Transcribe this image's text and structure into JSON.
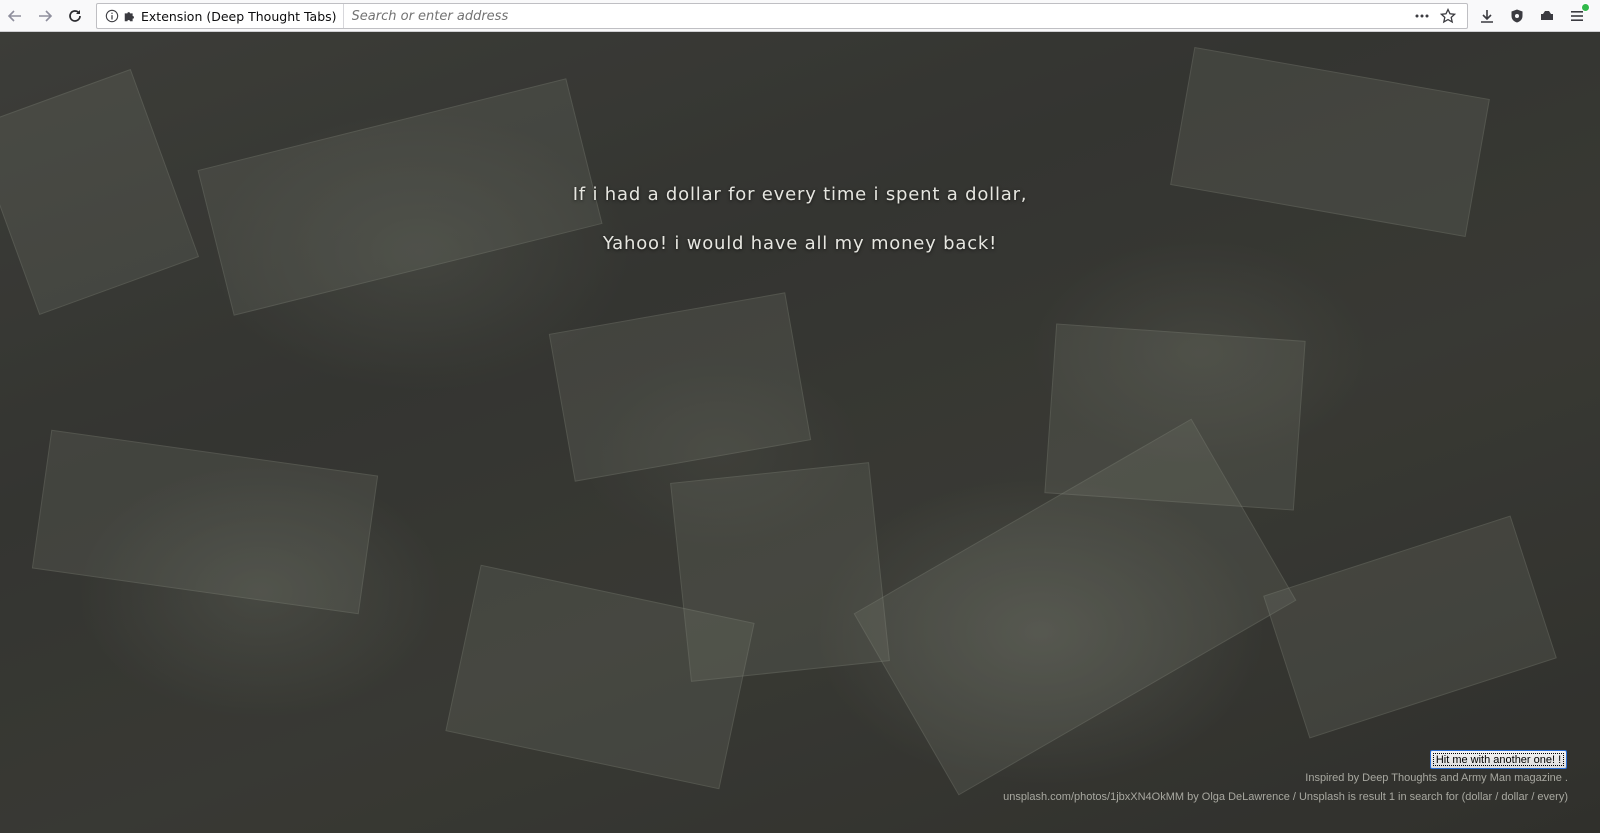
{
  "browser": {
    "nav": {
      "back_icon": "back-arrow-icon",
      "forward_icon": "forward-arrow-icon",
      "reload_icon": "reload-icon"
    },
    "urlbar": {
      "identity_label": "Extension (Deep Thought Tabs)",
      "placeholder": "Search or enter address",
      "actions": [
        "more-dots-icon",
        "bookmark-star-icon"
      ]
    },
    "toolbar_icons": [
      "download-icon",
      "shield-extension-icon",
      "sidebar-icon",
      "menu-icon"
    ],
    "colors": {
      "toolbar_bg": "#f9f9fa",
      "badge": "#30b94a"
    }
  },
  "page": {
    "quote_line1": "If i had a dollar for every time i spent a dollar,",
    "quote_line2": "Yahoo! i would have all my money back!",
    "another_button_label": "Hit me with another one! !",
    "credit_line1": "Inspired by Deep Thoughts and Army Man magazine .",
    "credit_line2": "unsplash.com/photos/1jbxXN4OkMM by Olga DeLawrence / Unsplash is result 1 in search for (dollar / dollar / every)"
  }
}
